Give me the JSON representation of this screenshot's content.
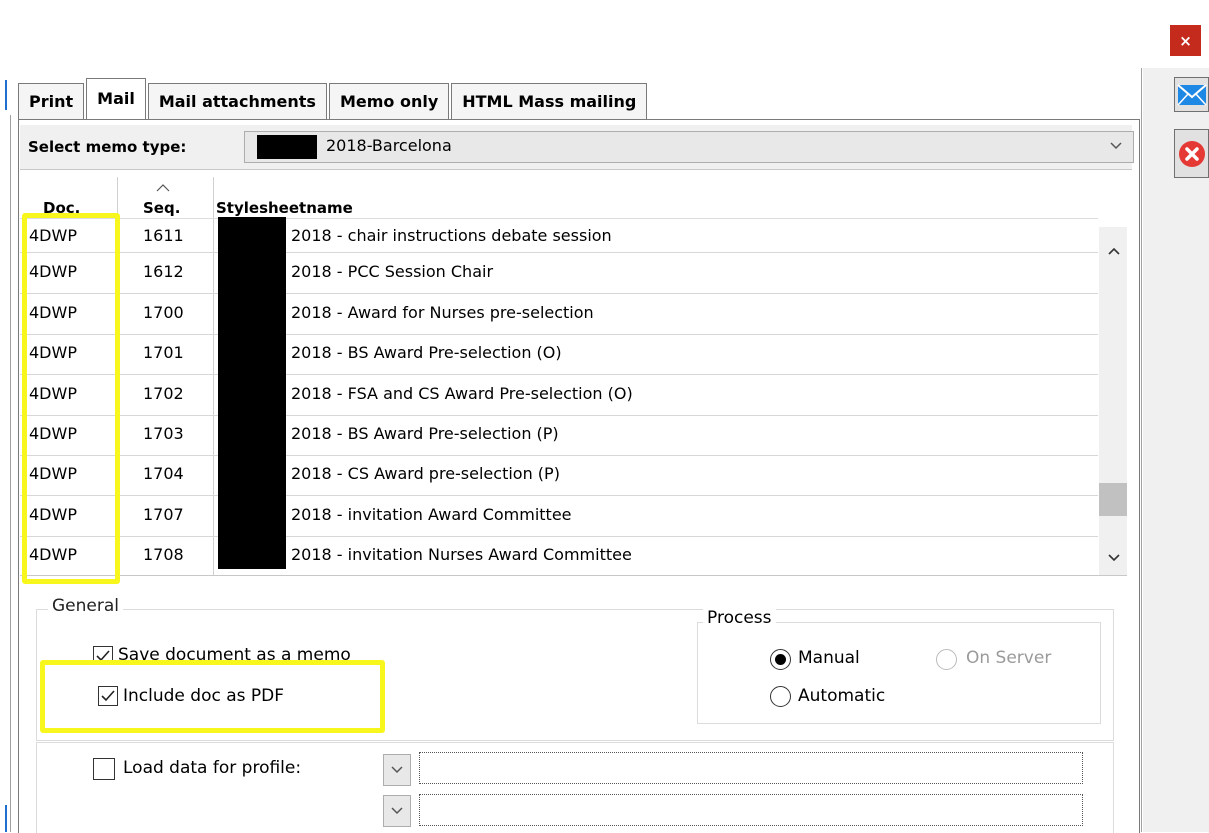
{
  "window": {
    "close_glyph": "×"
  },
  "tabs": [
    {
      "label": "Print",
      "active": false
    },
    {
      "label": "Mail",
      "active": true
    },
    {
      "label": "Mail attachments",
      "active": false
    },
    {
      "label": "Memo only",
      "active": false
    },
    {
      "label": "HTML Mass mailing",
      "active": false
    }
  ],
  "memo": {
    "label": "Select memo type:",
    "value": "2018-Barcelona"
  },
  "table": {
    "headers": {
      "doc": "Doc.",
      "seq": "Seq.",
      "name": "Stylesheetname"
    },
    "rows": [
      {
        "doc": "4DWP",
        "seq": "1611",
        "name": "2018 - chair instructions debate session"
      },
      {
        "doc": "4DWP",
        "seq": "1612",
        "name": "2018 - PCC Session Chair"
      },
      {
        "doc": "4DWP",
        "seq": "1700",
        "name": "2018 - Award for Nurses pre-selection"
      },
      {
        "doc": "4DWP",
        "seq": "1701",
        "name": "2018 - BS Award Pre-selection (O)"
      },
      {
        "doc": "4DWP",
        "seq": "1702",
        "name": "2018 - FSA and CS Award Pre-selection (O)"
      },
      {
        "doc": "4DWP",
        "seq": "1703",
        "name": "2018 - BS Award Pre-selection (P)"
      },
      {
        "doc": "4DWP",
        "seq": "1704",
        "name": "2018 - CS Award pre-selection (P)"
      },
      {
        "doc": "4DWP",
        "seq": "1707",
        "name": "2018 - invitation Award Committee"
      },
      {
        "doc": "4DWP",
        "seq": "1708",
        "name": "2018 - invitation Nurses Award Committee"
      }
    ]
  },
  "general": {
    "legend": "General",
    "save_memo": {
      "label": "Save document as a memo",
      "checked": true
    },
    "include_pdf": {
      "label": "Include doc as PDF",
      "checked": true
    },
    "load_profile": {
      "label": "Load data for profile:",
      "checked": false
    }
  },
  "process": {
    "legend": "Process",
    "manual": "Manual",
    "on_server": "On Server",
    "automatic": "Automatic",
    "selected": "Manual"
  },
  "icons": {
    "send": "mail-icon",
    "cancel": "cancel-icon"
  },
  "colors": {
    "highlight": "#f7f71e",
    "close": "#c42b1c",
    "mail_blue": "#1e88e5",
    "cancel_red": "#e53935"
  }
}
